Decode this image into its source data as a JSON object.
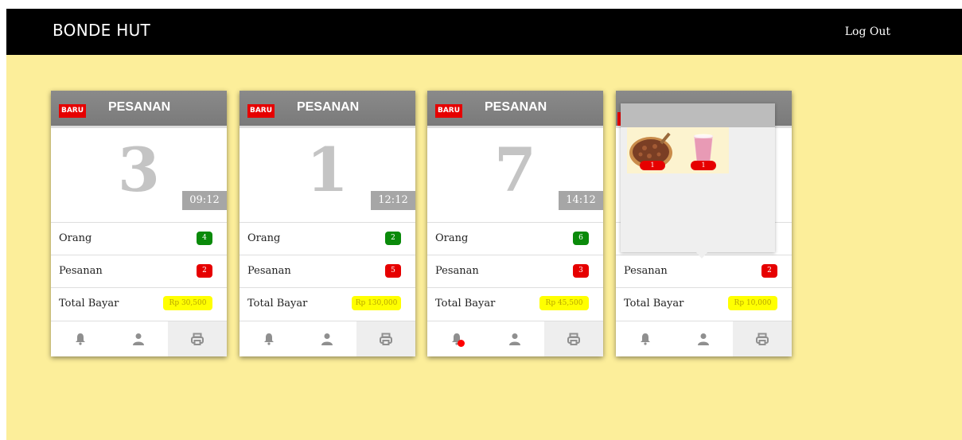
{
  "app": {
    "brand": "BONDE HUT",
    "logout_label": "Log Out"
  },
  "colors": {
    "background": "#fcee9a",
    "topbar": "#000000",
    "card_header": "#808080",
    "badge_new": "#e60000",
    "count_green": "#0a8a0a",
    "count_red": "#e60000",
    "total_highlight": "#ffff00"
  },
  "labels": {
    "new": "BARU",
    "order_title": "PESANAN",
    "people": "Orang",
    "orders": "Pesanan",
    "total": "Total Bayar"
  },
  "cards": [
    {
      "number": "3",
      "time": "09:12",
      "people": "4",
      "orders": "2",
      "total": "Rp 30,500",
      "bell_alert": false
    },
    {
      "number": "1",
      "time": "12:12",
      "people": "2",
      "orders": "5",
      "total": "Rp 130,000",
      "bell_alert": false
    },
    {
      "number": "7",
      "time": "14:12",
      "people": "6",
      "orders": "3",
      "total": "Rp 45,500",
      "bell_alert": true
    },
    {
      "number": "",
      "time": "",
      "people": "",
      "orders": "2",
      "total": "Rp 10,000",
      "bell_alert": false
    }
  ],
  "popup": {
    "items": [
      {
        "icon": "pizza-icon",
        "qty": "1"
      },
      {
        "icon": "drink-icon",
        "qty": "1"
      }
    ]
  },
  "icons": {
    "bell": "bell-icon",
    "user": "user-icon",
    "printer": "printer-icon"
  }
}
